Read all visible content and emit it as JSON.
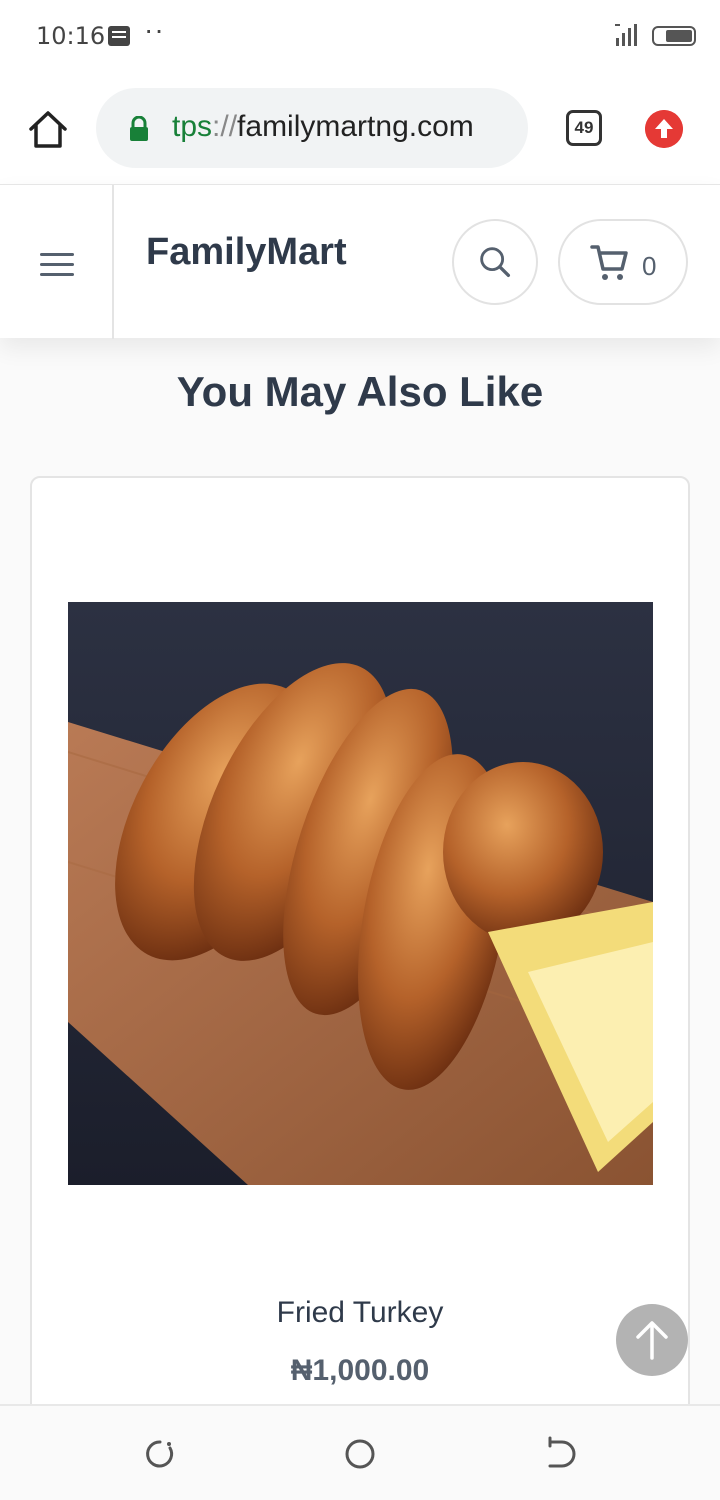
{
  "status_bar": {
    "time": "10:16",
    "dots": "··"
  },
  "browser": {
    "url_scheme": "tps",
    "url_separator": "://",
    "url_host": "familymartng.com",
    "tab_count": "49",
    "update_button_color": "#e53935",
    "lock_color": "#188038"
  },
  "header": {
    "brand": "FamilyMart",
    "cart_count": "0"
  },
  "section": {
    "title": "You May Also Like"
  },
  "product": {
    "name": "Fried Turkey",
    "price": "₦1,000.00"
  },
  "icons": {
    "home": "home-icon",
    "lock": "lock-icon",
    "tabs": "tabs-icon",
    "update": "arrow-up-icon",
    "menu": "hamburger-menu-icon",
    "search": "search-icon",
    "cart": "cart-icon",
    "scroll_top": "arrow-up-icon",
    "nav_recent": "recent-apps-icon",
    "nav_home": "home-circle-icon",
    "nav_back": "back-icon"
  },
  "colors": {
    "text_dark": "#2f3a4a",
    "text_muted": "#55606e",
    "url_green": "#188038"
  }
}
